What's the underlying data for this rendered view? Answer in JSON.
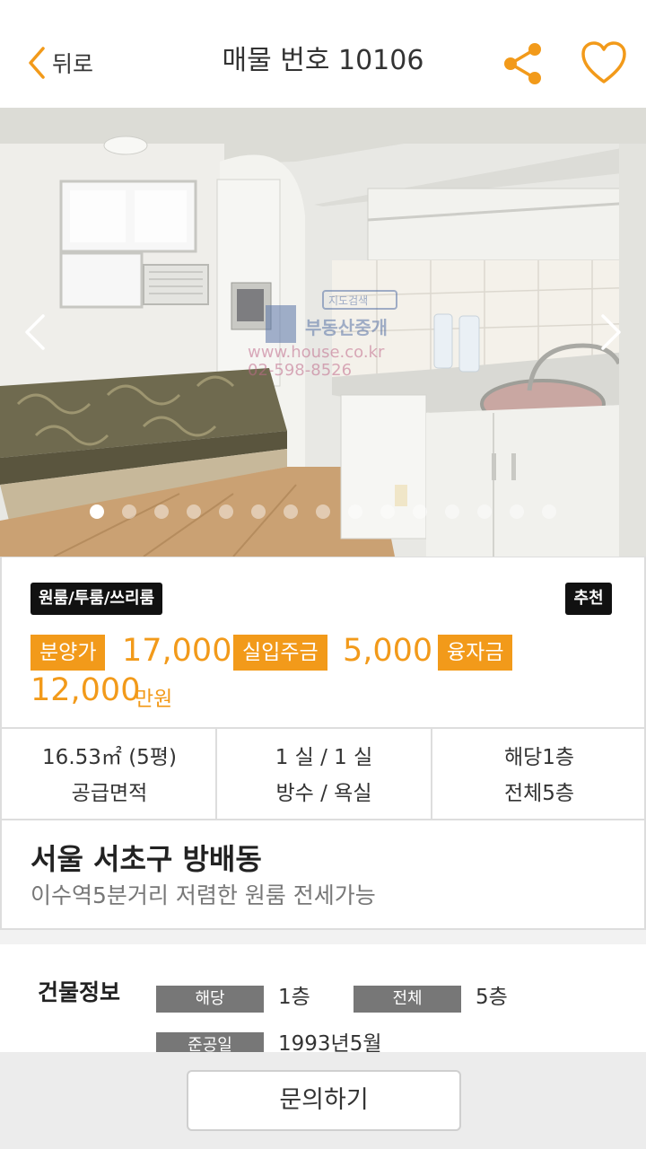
{
  "header": {
    "back_label": "뒤로",
    "title": "매물 번호 10106",
    "share_icon": "share-icon",
    "favorite_icon": "heart-icon",
    "accent_color": "#f29a1a"
  },
  "gallery": {
    "photo_count": 15,
    "current_index": 1,
    "watermark": {
      "search_label": "지도검색",
      "name": "부동산중개",
      "site": "www.house.co.kr",
      "phone": "02-598-8526"
    }
  },
  "listing": {
    "type_badge": "원룸/투룸/쓰리룸",
    "recommend_badge": "추천",
    "sale_price_label": "분양가",
    "sale_price": "17,000",
    "actual_investment_label": "실입주금",
    "actual_investment": "5,000",
    "loan_label": "융자금",
    "loan": "12,000",
    "unit": "만원"
  },
  "specs": [
    {
      "value": "16.53㎡ (5평)",
      "label": "공급면적"
    },
    {
      "value": "1 실 / 1 실",
      "label": "방수 / 욕실"
    },
    {
      "value": "해당1층",
      "label": "전체5층"
    }
  ],
  "address": {
    "title": "서울 서초구 방배동",
    "subtitle": "이수역5분거리 저렴한 원룸 전세가능"
  },
  "building": {
    "heading": "건물정보",
    "rows": [
      {
        "tag": "해당",
        "value": "1층"
      },
      {
        "tag": "전체",
        "value": "5층"
      },
      {
        "tag": "준공일",
        "value": "1993년5월"
      }
    ]
  },
  "footer": {
    "inquire_label": "문의하기"
  }
}
